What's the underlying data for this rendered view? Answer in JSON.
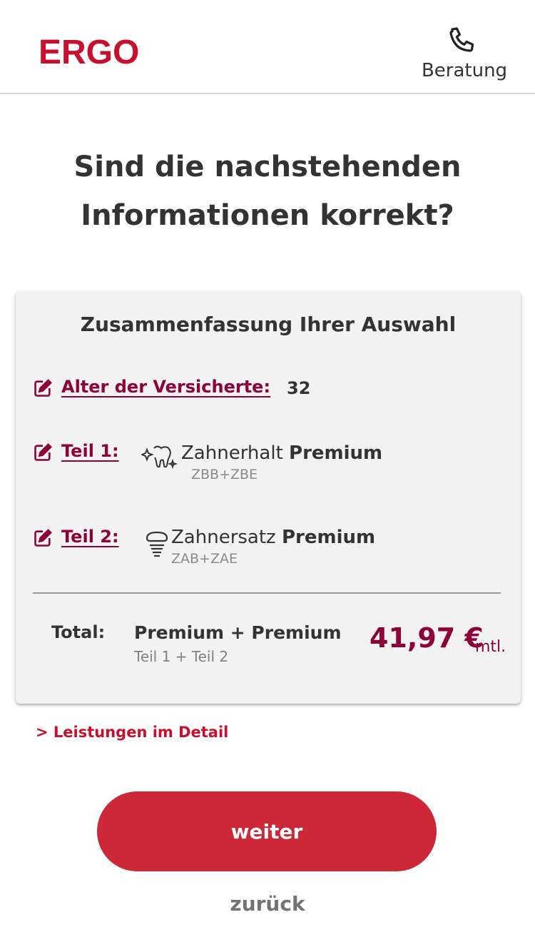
{
  "header": {
    "logo": "ERGO",
    "consult_label": "Beratung",
    "consult_icon": "phone-icon",
    "brand_color": "#c8102e"
  },
  "title": {
    "line1": "Sind die nachstehenden",
    "line2": "Informationen korrekt?"
  },
  "summary": {
    "title": "Zusammenfassung Ihrer Auswahl",
    "age": {
      "label": "Alter der Versicherte:",
      "value": "32",
      "icon": "edit-icon"
    },
    "part1": {
      "label": "Teil 1:",
      "product_name": "Zahnerhalt",
      "product_tier": "Premium",
      "product_code": "ZBB+ZBE",
      "icon": "tooth-sparkle-icon"
    },
    "part2": {
      "label": "Teil 2:",
      "product_name": "Zahnersatz",
      "product_tier": "Premium",
      "product_code": "ZAB+ZAE",
      "icon": "dental-implant-icon"
    },
    "total": {
      "label": "Total:",
      "name": "Premium + Premium",
      "sub": "Teil 1 + Teil 2",
      "price": "41,97 €",
      "unit": "mtl."
    }
  },
  "details_link": "> Leistungen im Detail",
  "actions": {
    "next_label": "weiter",
    "back_label": "zurück",
    "accent_color": "#cc2838",
    "link_color": "#8e0038"
  }
}
